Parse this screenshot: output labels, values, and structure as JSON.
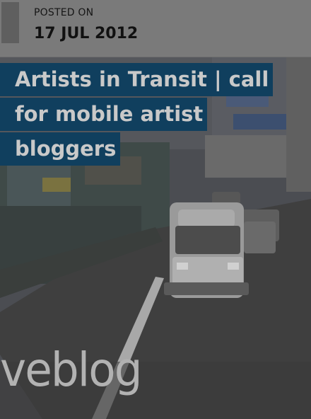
{
  "post": {
    "posted_label": "POSTED ON",
    "date": "17 JUL 2012",
    "title_lines": [
      "Artists in Transit | call",
      "for mobile artist",
      "bloggers"
    ]
  },
  "hero": {
    "watermark": "veblog",
    "image_description_icon": "street-traffic-photo"
  },
  "colors": {
    "title_background": "#103f5e",
    "title_text": "#c9c9c9",
    "header_background": "#7a7a7a",
    "overlay": "#6f6f6f"
  }
}
